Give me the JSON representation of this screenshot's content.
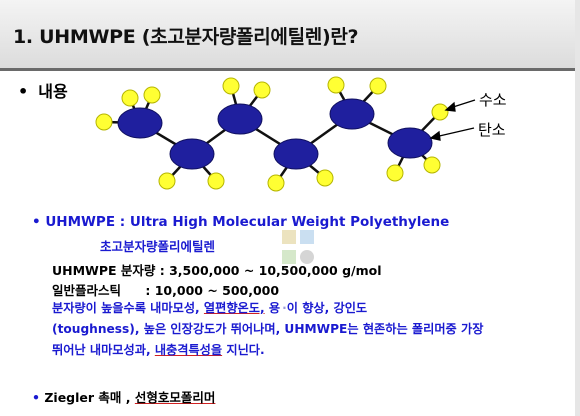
{
  "title": "1. UHMWPE (초고분자량폴리에틸렌)란?",
  "section_heading": "내용",
  "bullet_char": "•",
  "legend": {
    "hydrogen": "수소",
    "carbon": "탄소"
  },
  "colors": {
    "carbon": "#1f1f9e",
    "hydrogen": "#ffff33",
    "text_blue": "#1a1ad0",
    "band": "#dcdcdc"
  },
  "definition": {
    "abbr_prefix": "UHMWPE : ",
    "english": "Ultra High Molecular Weight Polyethylene",
    "korean": "초고분자량폴리에틸렌"
  },
  "weights": {
    "uhmwpe_label": "UHMWPE 분자량",
    "uhmwpe_value": ": 3,500,000 ~ 10,500,000 g/mol",
    "general_label": "일반플라스틱",
    "general_value": ": 10,000 ~ 500,000"
  },
  "paragraph": {
    "l1a": "분자량이 높을수록 내마모성,",
    "l1b": "열편향온도,",
    "l1c": " 용",
    "l1d": "이 향상",
    "l1e": ", 강인도",
    "l2": "(toughness), 높은 인장강도가 뛰어나며, UHMWPE는 현존하는 폴리머중 가장",
    "l3a": "뛰어난 내마모성과,",
    "l3b": "내충격특성을",
    "l3c": " 지닌다."
  },
  "ziegler": {
    "label": "Ziegler 촉매 ,",
    "value": "선형호모폴리머"
  }
}
